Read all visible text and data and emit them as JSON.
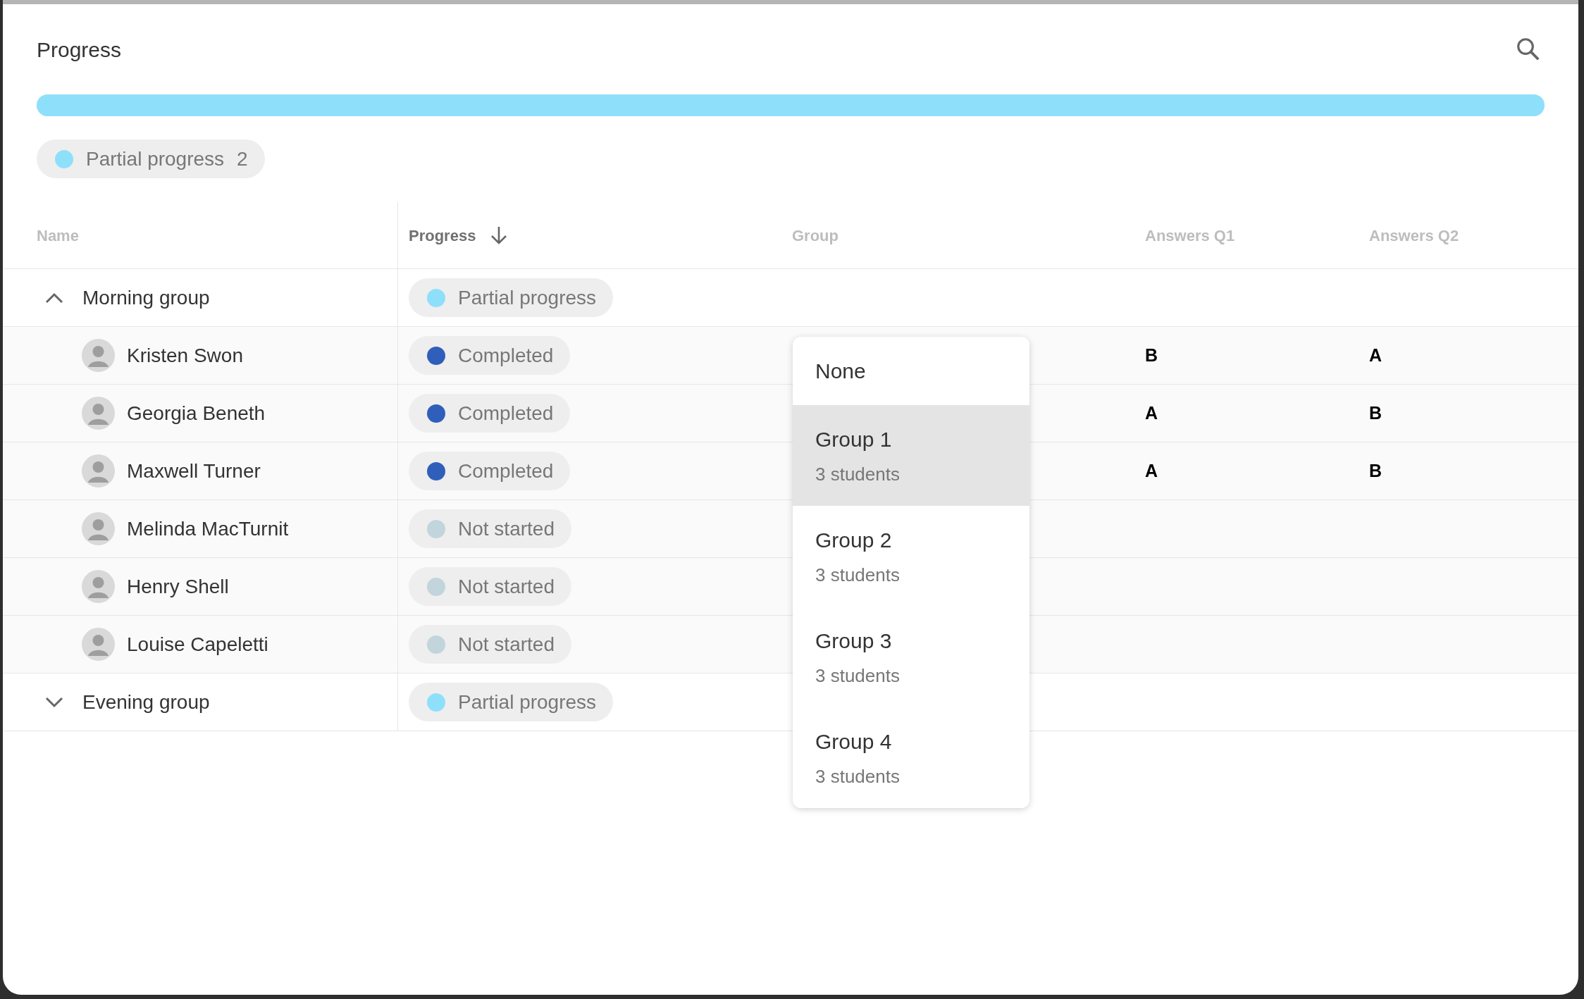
{
  "header": {
    "title": "Progress"
  },
  "progress_bar": {
    "level": 1,
    "color": "#8ee0fa"
  },
  "summary_chip": {
    "label": "Partial progress",
    "count": "2",
    "color": "#8ee0fa"
  },
  "table": {
    "columns": [
      {
        "label": "Name",
        "sorted": false
      },
      {
        "label": "Progress",
        "sorted": true
      },
      {
        "label": "Group",
        "sorted": false
      },
      {
        "label": "Answers Q1",
        "sorted": false
      },
      {
        "label": "Answers Q2",
        "sorted": false
      }
    ],
    "rows": [
      {
        "kind": "group",
        "name": "Morning group",
        "expanded": true,
        "status": {
          "label": "Partial progress",
          "color": "#8ee0fa"
        },
        "children": [
          {
            "kind": "student",
            "name": "Kristen Swon",
            "status": {
              "label": "Completed",
              "color": "#2f5fba"
            },
            "q1": "B",
            "q2": "A"
          },
          {
            "kind": "student",
            "name": "Georgia Beneth",
            "status": {
              "label": "Completed",
              "color": "#2f5fba"
            },
            "q1": "A",
            "q2": "B"
          },
          {
            "kind": "student",
            "name": "Maxwell Turner",
            "status": {
              "label": "Completed",
              "color": "#2f5fba"
            },
            "q1": "A",
            "q2": "B"
          },
          {
            "kind": "student",
            "name": "Melinda MacTurnit",
            "status": {
              "label": "Not started",
              "color": "#c2d5dc"
            }
          },
          {
            "kind": "student",
            "name": "Henry Shell",
            "status": {
              "label": "Not started",
              "color": "#c2d5dc"
            }
          },
          {
            "kind": "student",
            "name": "Louise Capeletti",
            "status": {
              "label": "Not started",
              "color": "#c2d5dc"
            }
          }
        ]
      },
      {
        "kind": "group",
        "name": "Evening group",
        "expanded": false,
        "status": {
          "label": "Partial progress",
          "color": "#8ee0fa"
        }
      }
    ]
  },
  "group_menu": {
    "options": [
      {
        "label": "None",
        "selected": false
      },
      {
        "label": "Group 1",
        "sub": "3 students",
        "selected": true
      },
      {
        "label": "Group 2",
        "sub": "3 students",
        "selected": false
      },
      {
        "label": "Group 3",
        "sub": "3 students",
        "selected": false
      },
      {
        "label": "Group 4",
        "sub": "3 students",
        "selected": false
      }
    ]
  }
}
